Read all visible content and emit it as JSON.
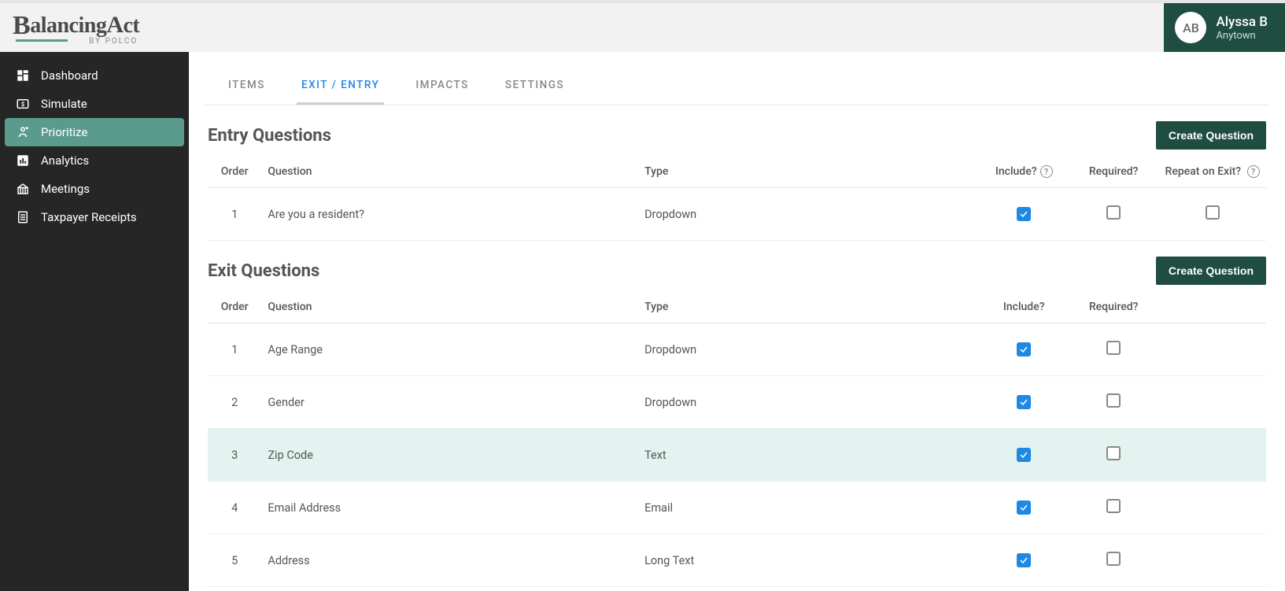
{
  "header": {
    "logo_main": "BalancingAct",
    "logo_sub": "BY POLCO",
    "user_initials": "AB",
    "user_name": "Alyssa B",
    "user_org": "Anytown"
  },
  "sidebar": {
    "items": [
      {
        "label": "Dashboard",
        "icon": "dashboard",
        "active": false
      },
      {
        "label": "Simulate",
        "icon": "simulate",
        "active": false
      },
      {
        "label": "Prioritize",
        "icon": "prioritize",
        "active": true
      },
      {
        "label": "Analytics",
        "icon": "analytics",
        "active": false
      },
      {
        "label": "Meetings",
        "icon": "meetings",
        "active": false
      },
      {
        "label": "Taxpayer Receipts",
        "icon": "receipts",
        "active": false
      }
    ]
  },
  "tabs": [
    {
      "label": "ITEMS",
      "active": false
    },
    {
      "label": "EXIT / ENTRY",
      "active": true
    },
    {
      "label": "IMPACTS",
      "active": false
    },
    {
      "label": "SETTINGS",
      "active": false
    }
  ],
  "entry_section": {
    "title": "Entry Questions",
    "create_label": "Create Question",
    "columns": {
      "order": "Order",
      "question": "Question",
      "type": "Type",
      "include": "Include?",
      "required": "Required?",
      "repeat": "Repeat on Exit?"
    },
    "rows": [
      {
        "order": "1",
        "question": "Are you a resident?",
        "type": "Dropdown",
        "include": true,
        "required": false,
        "repeat": false
      }
    ]
  },
  "exit_section": {
    "title": "Exit Questions",
    "create_label": "Create Question",
    "columns": {
      "order": "Order",
      "question": "Question",
      "type": "Type",
      "include": "Include?",
      "required": "Required?"
    },
    "rows": [
      {
        "order": "1",
        "question": "Age Range",
        "type": "Dropdown",
        "include": true,
        "required": false,
        "highlight": false
      },
      {
        "order": "2",
        "question": "Gender",
        "type": "Dropdown",
        "include": true,
        "required": false,
        "highlight": false
      },
      {
        "order": "3",
        "question": "Zip Code",
        "type": "Text",
        "include": true,
        "required": false,
        "highlight": true
      },
      {
        "order": "4",
        "question": "Email Address",
        "type": "Email",
        "include": true,
        "required": false,
        "highlight": false
      },
      {
        "order": "5",
        "question": "Address",
        "type": "Long Text",
        "include": true,
        "required": false,
        "highlight": false
      }
    ]
  }
}
